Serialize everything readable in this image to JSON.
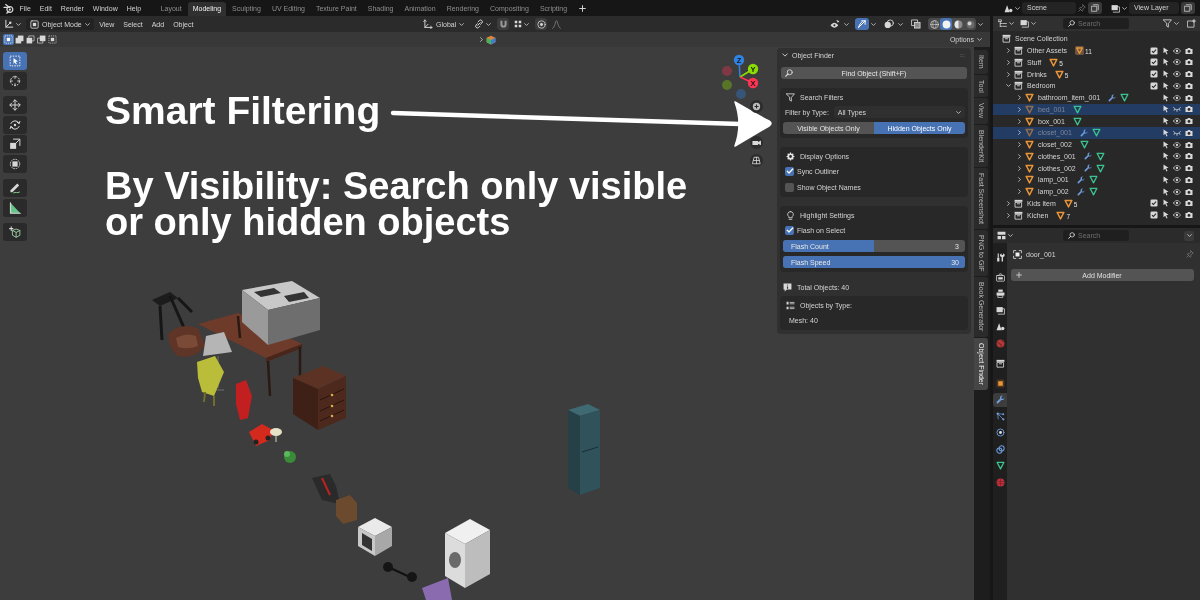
{
  "top_bar": {
    "menus": [
      "File",
      "Edit",
      "Render",
      "Window",
      "Help"
    ],
    "workspaces": [
      {
        "label": "Layout",
        "selected": false
      },
      {
        "label": "Modeling",
        "selected": true
      },
      {
        "label": "Sculpting",
        "selected": false
      },
      {
        "label": "UV Editing",
        "selected": false
      },
      {
        "label": "Texture Paint",
        "selected": false
      },
      {
        "label": "Shading",
        "selected": false
      },
      {
        "label": "Animation",
        "selected": false
      },
      {
        "label": "Rendering",
        "selected": false
      },
      {
        "label": "Compositing",
        "selected": false
      },
      {
        "label": "Scripting",
        "selected": false
      }
    ],
    "scene": "Scene",
    "view_layer": "View Layer"
  },
  "viewport": {
    "header": {
      "mode": "Object Mode",
      "menus": [
        "View",
        "Select",
        "Add",
        "Object"
      ],
      "orientation": "Global",
      "toggles": [
        {
          "kind": "visibility",
          "on": false
        },
        {
          "kind": "gizmos",
          "on": true
        },
        {
          "kind": "overlays",
          "on": false
        },
        {
          "kind": "xray",
          "on": false
        }
      ],
      "shading": [
        {
          "kind": "wireframe",
          "selected": false
        },
        {
          "kind": "solid",
          "selected": true
        },
        {
          "kind": "material",
          "selected": false
        },
        {
          "kind": "rendered",
          "selected": false
        }
      ]
    },
    "tool_header": {
      "select_modes": [
        {
          "kind": "set",
          "selected": true
        },
        {
          "kind": "extend",
          "selected": false
        },
        {
          "kind": "subtract",
          "selected": false
        },
        {
          "kind": "invert",
          "selected": false
        },
        {
          "kind": "intersect",
          "selected": false
        }
      ],
      "options": "Options"
    },
    "toolbar": [
      [
        {
          "kind": "select_box",
          "selected": true
        },
        {
          "kind": "cursor",
          "selected": false
        }
      ],
      [
        {
          "kind": "move",
          "selected": false
        },
        {
          "kind": "rotate",
          "selected": false
        },
        {
          "kind": "scale",
          "selected": false
        },
        {
          "kind": "transform",
          "selected": false
        }
      ],
      [
        {
          "kind": "annotate",
          "selected": false
        },
        {
          "kind": "measure",
          "selected": false
        }
      ],
      [
        {
          "kind": "add_cube",
          "selected": false
        }
      ]
    ],
    "gizmo": {
      "axes": [
        {
          "label": "Z",
          "color": "#2f83e3"
        },
        {
          "label": "Y",
          "color": "#8bdc00"
        },
        {
          "label": "X",
          "color": "#ff3352"
        }
      ]
    },
    "caption": {
      "title": "Smart Filtering",
      "text": "By Visibility: Search only visible or only hidden objects"
    }
  },
  "sidebar": {
    "panel": {
      "title": "Object Finder",
      "expanded": true
    },
    "find_button": "Find Object (Shift+F)",
    "sections": [
      {
        "kind": "filters",
        "title": "Search Filters",
        "rows": [
          {
            "kind": "dropdown",
            "label": "Filter by Type:",
            "value": "All Types"
          },
          {
            "kind": "toggles",
            "options": [
              {
                "label": "Visible Objects Only",
                "selected": false
              },
              {
                "label": "Hidden Objects Only",
                "selected": true
              }
            ]
          }
        ]
      },
      {
        "kind": "display",
        "title": "Display Options",
        "rows": [
          {
            "kind": "checkbox",
            "label": "Sync Outliner",
            "checked": true
          },
          {
            "kind": "checkbox",
            "label": "Show Object Names",
            "checked": false
          }
        ]
      },
      {
        "kind": "highlight",
        "title": "Highlight Settings",
        "rows": [
          {
            "kind": "checkbox",
            "label": "Flash on Select",
            "checked": true
          },
          {
            "kind": "slider",
            "label": "Flash Count",
            "reading": "3",
            "level": 0.5
          },
          {
            "kind": "slider",
            "label": "Flash Speed",
            "reading": "30",
            "level": 1
          }
        ]
      }
    ],
    "total": "Total Objects: 40",
    "by_type": {
      "title": "Objects by Type:",
      "lines": [
        "Mesh: 40"
      ]
    }
  },
  "sidebar_tabs": [
    {
      "label": "Item",
      "selected": false
    },
    {
      "label": "Tool",
      "selected": false
    },
    {
      "label": "View",
      "selected": false
    },
    {
      "label": "BlenderKit",
      "selected": false
    },
    {
      "label": "Fast Screenshot",
      "selected": false
    },
    {
      "label": "PNG to GIF",
      "selected": false
    },
    {
      "label": "Book Generator",
      "selected": false
    },
    {
      "label": "Object Finder",
      "selected": true
    }
  ],
  "outliner": {
    "search": {
      "placeholder": "Search"
    },
    "tree": [
      {
        "kind": "scene",
        "label": "Scene Collection",
        "children": [
          {
            "kind": "collection",
            "label": "Other Assets",
            "expanded": false,
            "count": "11",
            "contains_active": true,
            "included": true,
            "visible": true
          },
          {
            "kind": "collection",
            "label": "Stuff",
            "expanded": false,
            "count": "5",
            "contains_active": false,
            "included": true,
            "visible": true
          },
          {
            "kind": "collection",
            "label": "Drinks",
            "expanded": false,
            "count": "5",
            "contains_active": false,
            "included": true,
            "visible": true
          },
          {
            "kind": "collection",
            "label": "Bedroom",
            "expanded": true,
            "included": true,
            "visible": true,
            "children": [
              {
                "kind": "object",
                "label": "bathroom_item_001",
                "expanded": false,
                "selected": false,
                "visible": true,
                "modifier": true
              },
              {
                "kind": "object",
                "label": "bed_001",
                "expanded": false,
                "selected": true,
                "visible": false,
                "modifier": false
              },
              {
                "kind": "object",
                "label": "box_001",
                "expanded": false,
                "selected": false,
                "visible": true,
                "modifier": false
              },
              {
                "kind": "object",
                "label": "closet_001",
                "expanded": false,
                "selected": true,
                "visible": false,
                "modifier": true
              },
              {
                "kind": "object",
                "label": "closet_002",
                "expanded": false,
                "selected": false,
                "visible": true,
                "modifier": false
              },
              {
                "kind": "object",
                "label": "clothes_001",
                "expanded": false,
                "selected": false,
                "visible": true,
                "modifier": true
              },
              {
                "kind": "object",
                "label": "clothes_002",
                "expanded": false,
                "selected": false,
                "visible": true,
                "modifier": true
              },
              {
                "kind": "object",
                "label": "lamp_001",
                "expanded": false,
                "selected": false,
                "visible": true,
                "modifier": true
              },
              {
                "kind": "object",
                "label": "lamp_002",
                "expanded": false,
                "selected": false,
                "visible": true,
                "modifier": true
              }
            ]
          },
          {
            "kind": "collection",
            "label": "Kids item",
            "expanded": false,
            "count": "5",
            "contains_active": false,
            "included": true,
            "visible": true
          },
          {
            "kind": "collection",
            "label": "Kichen",
            "expanded": false,
            "count": "7",
            "contains_active": false,
            "included": true,
            "visible": true
          }
        ]
      }
    ]
  },
  "properties": {
    "search": {
      "placeholder": "Search"
    },
    "tab_groups": [
      [
        {
          "kind": "tool",
          "selected": false
        }
      ],
      [
        {
          "kind": "render",
          "selected": false
        },
        {
          "kind": "output",
          "selected": false
        },
        {
          "kind": "view_layer",
          "selected": false
        },
        {
          "kind": "scene",
          "selected": false
        },
        {
          "kind": "world",
          "selected": false
        }
      ],
      [
        {
          "kind": "collection",
          "selected": false
        }
      ],
      [
        {
          "kind": "object",
          "selected": false
        },
        {
          "kind": "modifiers",
          "selected": true
        },
        {
          "kind": "particles",
          "selected": false
        },
        {
          "kind": "physics",
          "selected": false
        },
        {
          "kind": "constraints",
          "selected": false
        },
        {
          "kind": "data",
          "selected": false
        },
        {
          "kind": "material",
          "selected": false
        }
      ]
    ],
    "object_name": "door_001",
    "add_button": "Add Modifier"
  }
}
